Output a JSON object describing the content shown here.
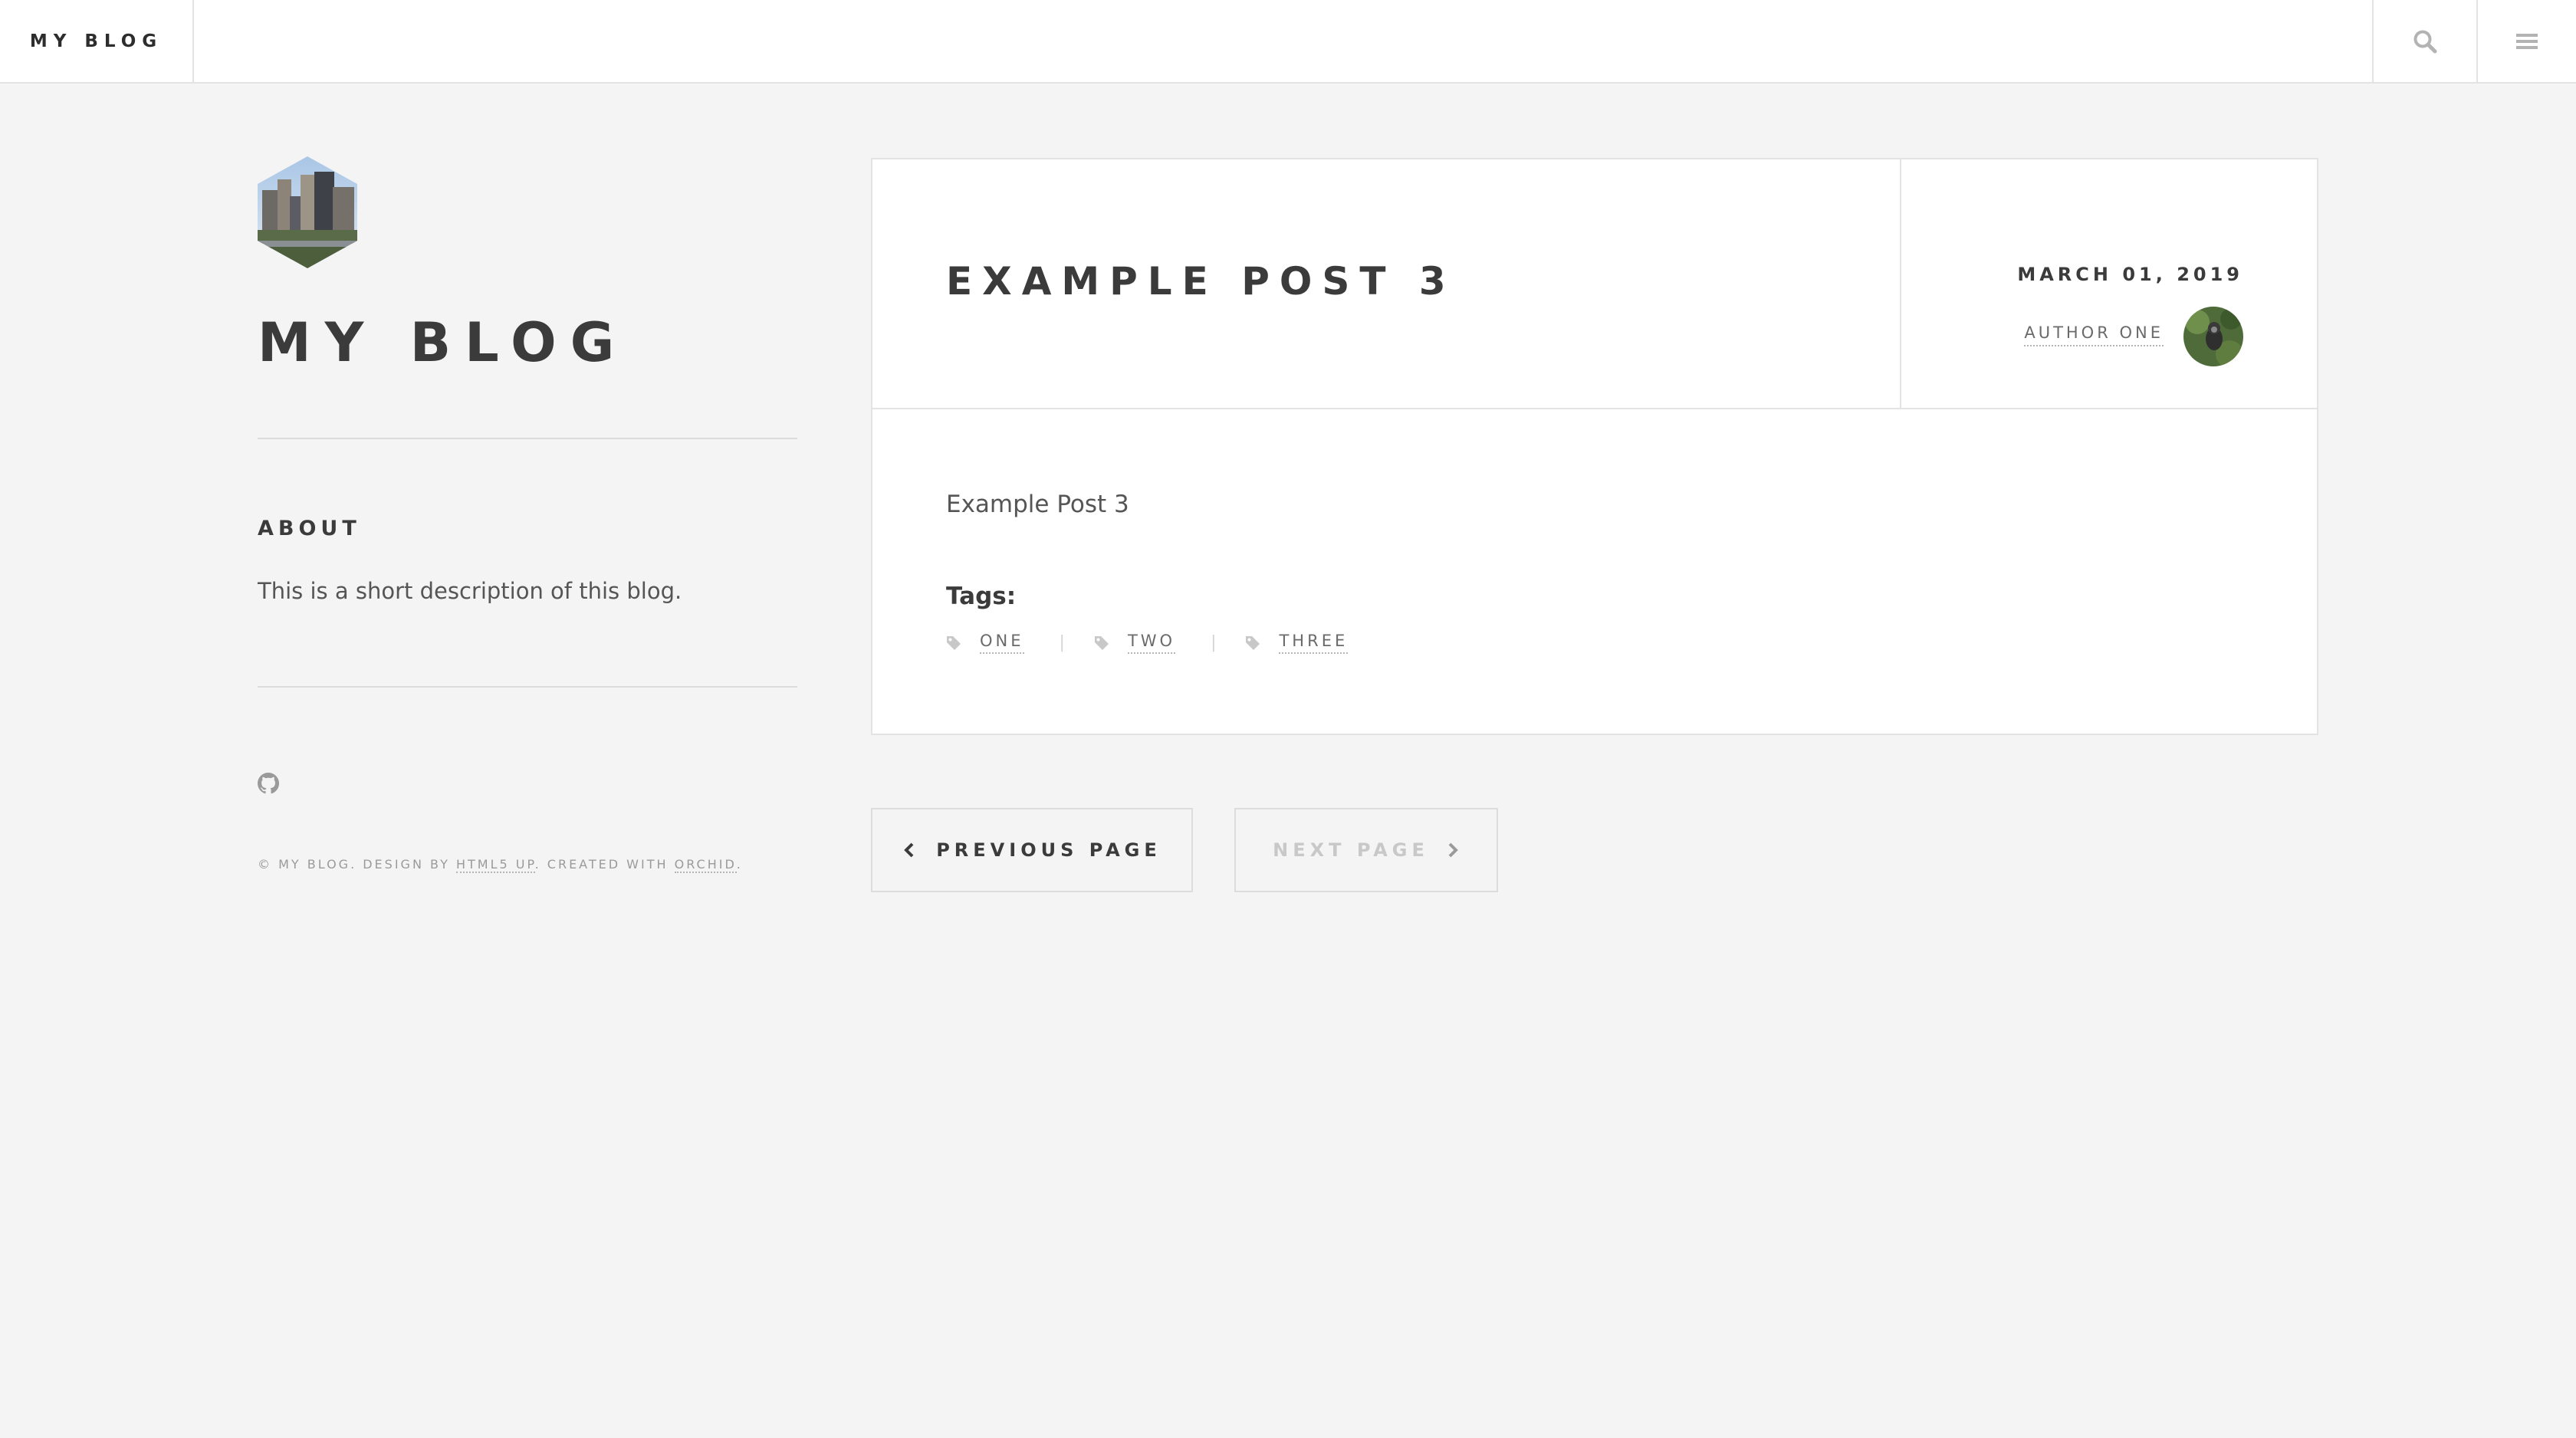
{
  "header": {
    "brand": "MY BLOG",
    "search_icon": "search-icon",
    "menu_icon": "hamburger-menu-icon"
  },
  "sidebar": {
    "logo_icon": "city-skyline-hexagon-logo",
    "title": "MY BLOG",
    "about": {
      "heading": "ABOUT",
      "text": "This is a short description of this blog."
    },
    "social_icon": "github-icon",
    "footer": {
      "prefix": "© MY BLOG. DESIGN BY ",
      "design_link": "HTML5 UP",
      "middle": ". CREATED WITH ",
      "created_link": "ORCHID",
      "suffix": "."
    }
  },
  "post": {
    "title": "EXAMPLE POST 3",
    "date": "MARCH 01, 2019",
    "author": "AUTHOR ONE",
    "body": "Example Post 3",
    "tags_label": "Tags:",
    "tags": [
      "ONE",
      "TWO",
      "THREE"
    ]
  },
  "pagination": {
    "prev_label": "PREVIOUS PAGE",
    "next_label": "NEXT PAGE",
    "next_disabled": true
  },
  "colors": {
    "background": "#f4f4f4",
    "card": "#ffffff",
    "border": "#e3e3e3",
    "text_dark": "#3c3b3b",
    "text_muted": "#9a9a9a"
  }
}
